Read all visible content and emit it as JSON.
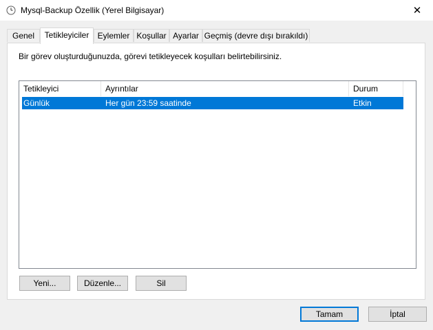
{
  "window": {
    "title": "Mysql-Backup Özellik (Yerel Bilgisayar)",
    "close_glyph": "✕"
  },
  "tabs": [
    {
      "label": "Genel"
    },
    {
      "label": "Tetikleyiciler"
    },
    {
      "label": "Eylemler"
    },
    {
      "label": "Koşullar"
    },
    {
      "label": "Ayarlar"
    },
    {
      "label": "Geçmiş (devre dışı bırakıldı)"
    }
  ],
  "panel": {
    "description": "Bir görev oluşturduğunuzda, görevi tetikleyecek koşulları belirtebilirsiniz.",
    "columns": [
      "Tetikleyici",
      "Ayrıntılar",
      "Durum"
    ],
    "rows": [
      {
        "trigger": "Günlük",
        "details": "Her gün 23:59 saatinde",
        "status": "Etkin"
      }
    ],
    "buttons": {
      "new": "Yeni...",
      "edit": "Düzenle...",
      "delete": "Sil"
    }
  },
  "footer": {
    "ok": "Tamam",
    "cancel": "İptal"
  },
  "colors": {
    "selection": "#0078d7",
    "default_button_border": "#0078d7"
  }
}
